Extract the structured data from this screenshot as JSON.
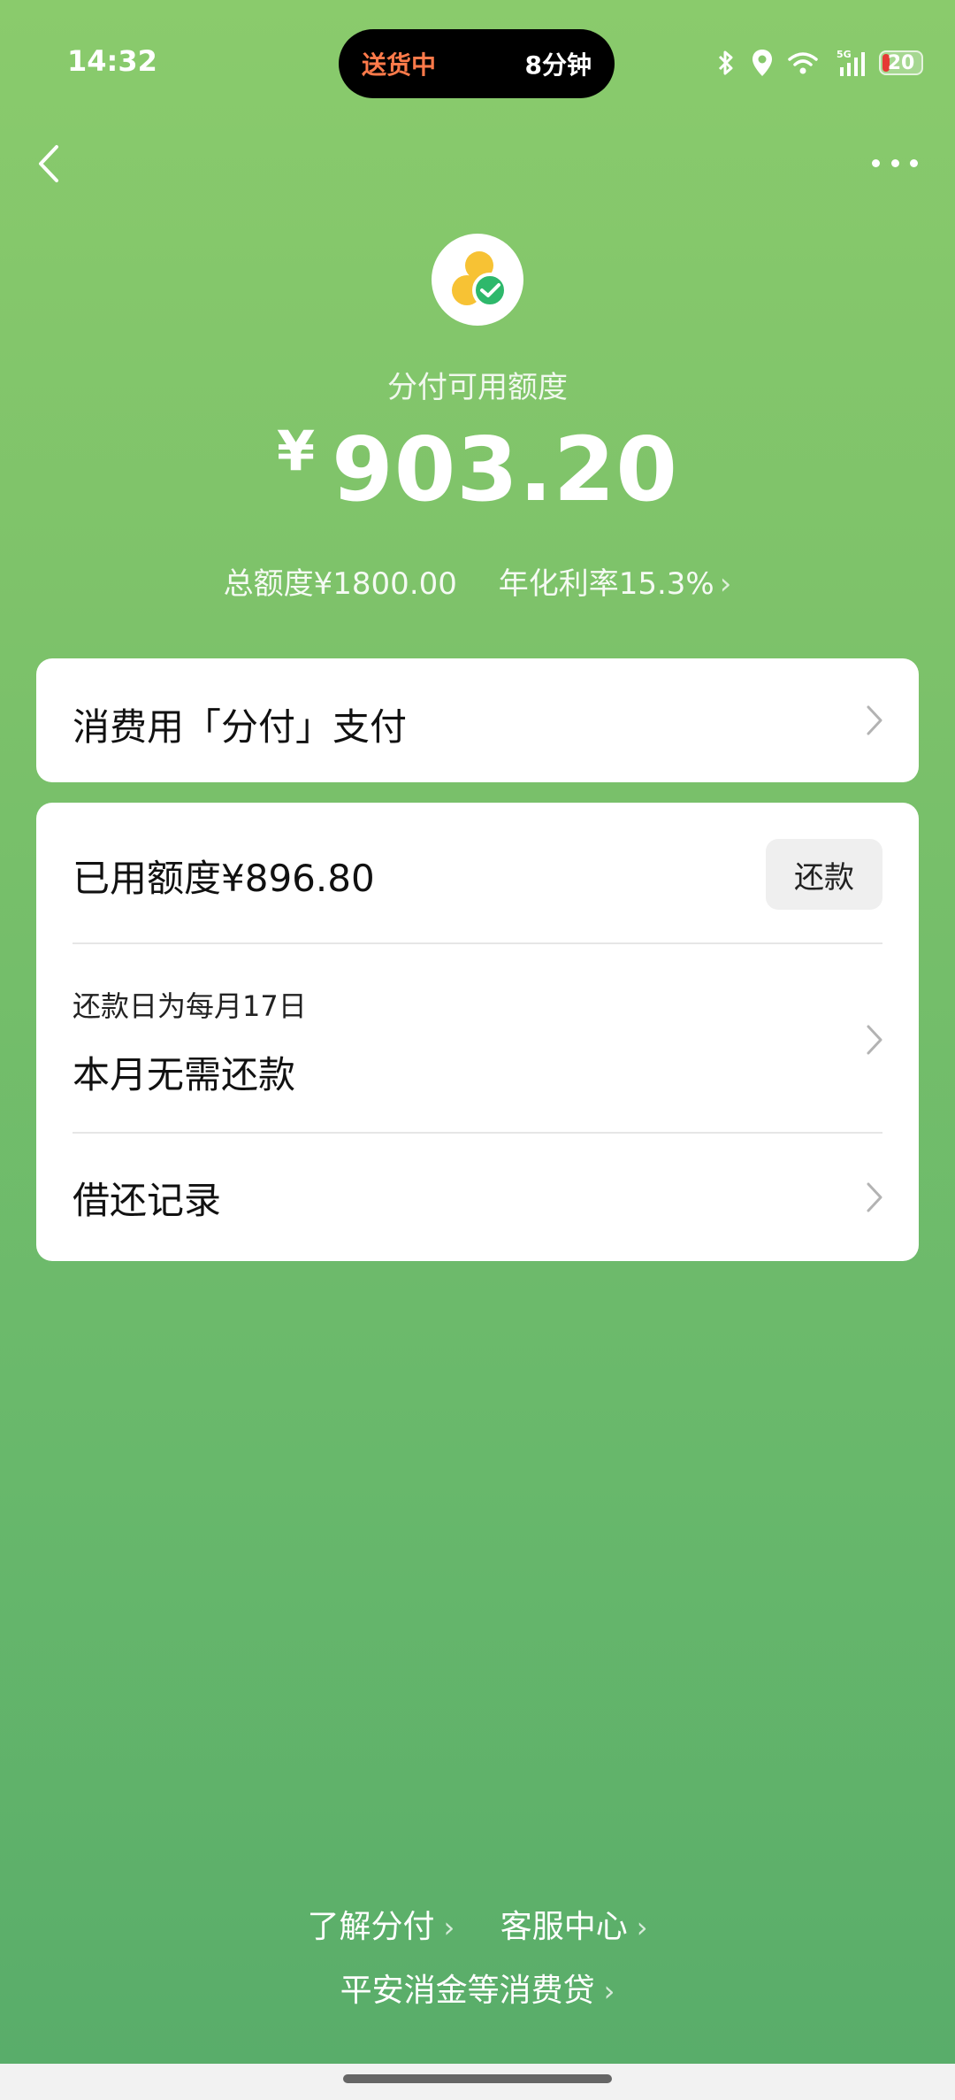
{
  "status_bar": {
    "time": "14:32",
    "island_status": "送货中",
    "island_eta": "8分钟",
    "network": "5G",
    "battery": "20"
  },
  "nav": {
    "back_icon": "chevron-left-icon",
    "more_icon": "more-dots-icon"
  },
  "header": {
    "title": "分付可用额度",
    "currency": "¥",
    "amount": "903.20",
    "total_limit": "总额度¥1800.00",
    "apr": "年化利率15.3%"
  },
  "pay_card": {
    "label": "消费用「分付」支付"
  },
  "account_card": {
    "used_limit": "已用额度¥896.80",
    "repay_button": "还款",
    "due_date": "还款日为每月17日",
    "repay_status": "本月无需还款",
    "records": "借还记录"
  },
  "footer": {
    "learn": "了解分付",
    "service": "客服中心",
    "loan": "平安消金等消费贷"
  },
  "colors": {
    "bg_top": "#8acb6c",
    "bg_bottom": "#58ac6a",
    "island_accent": "#ff7a4a",
    "check_green": "#2eb86b",
    "logo_yellow": "#f7c234"
  }
}
